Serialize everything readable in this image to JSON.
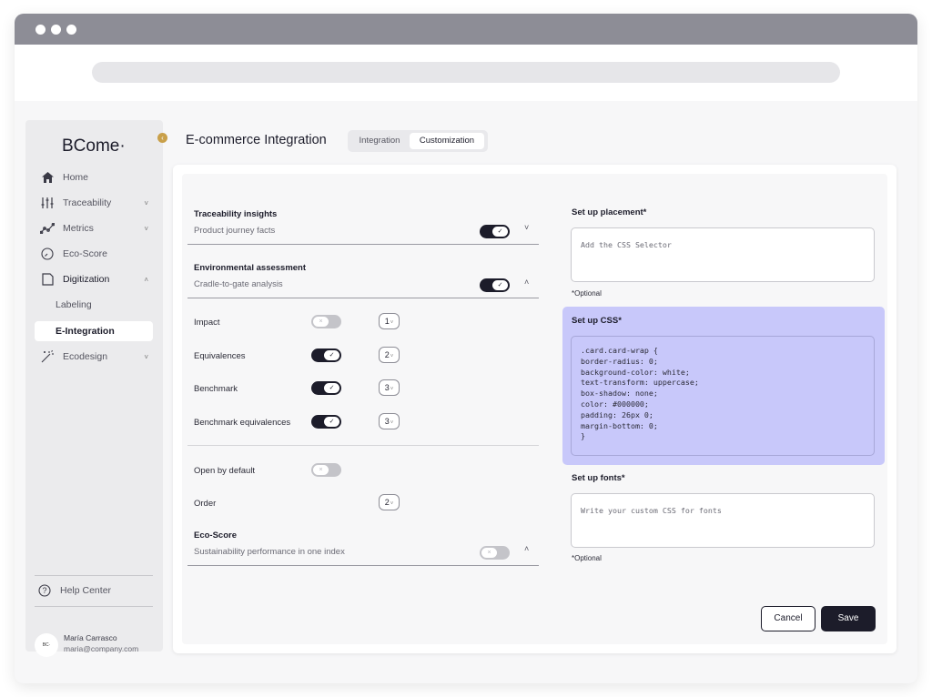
{
  "sidebar": {
    "logo": "BCome·",
    "collapse_icon": "‹",
    "items": [
      {
        "label": "Home",
        "icon": "home-icon"
      },
      {
        "label": "Traceability",
        "icon": "sliders-icon"
      },
      {
        "label": "Metrics",
        "icon": "chart-line-icon"
      },
      {
        "label": "Eco-Score",
        "icon": "gauge-icon"
      },
      {
        "label": "Digitization",
        "icon": "document-icon"
      },
      {
        "label": "Labeling"
      },
      {
        "label": "E-Integration"
      },
      {
        "label": "Ecodesign",
        "icon": "magic-wand-icon"
      }
    ],
    "help": "Help Center",
    "user": {
      "avatar": "BC·",
      "name": "María Carrasco",
      "email": "maria@company.com"
    }
  },
  "header": {
    "title": "E-commerce Integration",
    "tabs": [
      {
        "label": "Integration"
      },
      {
        "label": "Customization"
      }
    ],
    "active_tab": "Customization"
  },
  "left": {
    "traceability": {
      "title": "Traceability insights",
      "subtitle": "Product journey facts",
      "enabled": true,
      "expanded": false
    },
    "environmental": {
      "title": "Environmental assessment",
      "subtitle": "Cradle-to-gate analysis",
      "enabled": true,
      "expanded": true
    },
    "rows": [
      {
        "label": "Impact",
        "enabled": false,
        "order": "1"
      },
      {
        "label": "Equivalences",
        "enabled": true,
        "order": "2"
      },
      {
        "label": "Benchmark",
        "enabled": true,
        "order": "3"
      },
      {
        "label": "Benchmark equivalences",
        "enabled": true,
        "order": "3"
      }
    ],
    "open_default": {
      "label": "Open by default",
      "enabled": false
    },
    "order": {
      "label": "Order",
      "value": "2"
    },
    "ecoscore": {
      "title": "Eco-Score",
      "subtitle": "Sustainability performance in one index",
      "enabled": false,
      "expanded": true
    }
  },
  "right": {
    "placement": {
      "label": "Set up placement*",
      "placeholder": "Add the CSS Selector",
      "note": "*Optional"
    },
    "css": {
      "label": "Set up CSS*",
      "code": ".card.card-wrap {\nborder-radius: 0;\nbackground-color: white;\ntext-transform: uppercase;\nbox-shadow: none;\ncolor: #000000;\npadding: 26px 0;\nmargin-bottom: 0;\n}"
    },
    "fonts": {
      "label": "Set up fonts*",
      "placeholder": "Write your custom CSS for fonts",
      "note": "*Optional"
    }
  },
  "actions": {
    "cancel": "Cancel",
    "save": "Save"
  },
  "colors": {
    "accent": "#1c1c2a",
    "highlight": "#c8c8fa",
    "collapse": "#c9a04a"
  },
  "glyphs": {
    "check": "✓",
    "cross": "×",
    "chev_down": "˅",
    "chev_up": "˄",
    "caret": "˅"
  }
}
